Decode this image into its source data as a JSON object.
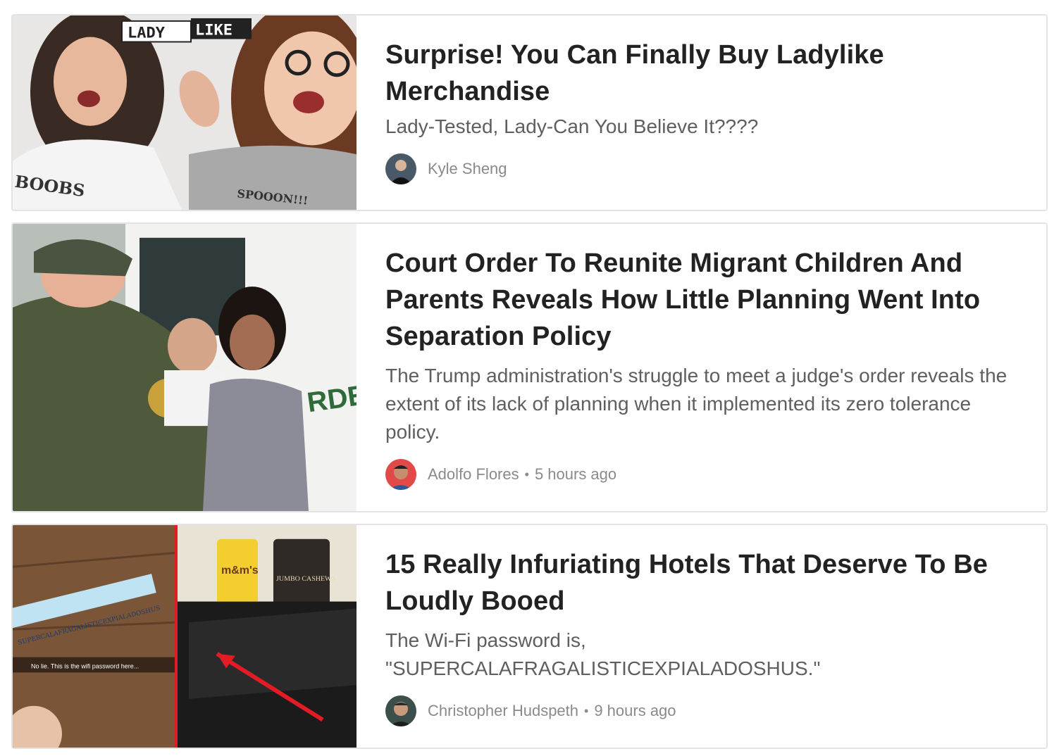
{
  "articles": [
    {
      "title": "Surprise! You Can Finally Buy Ladylike Merchandise",
      "description": "Lady-Tested, Lady-Can You Believe It????",
      "author": "Kyle Sheng",
      "time": "",
      "image": {
        "brand_lady": "LADY",
        "brand_like": "LIKE",
        "shirt_left": "BOOBS",
        "shirt_right": "SPOOON!!!"
      }
    },
    {
      "title": "Court Order To Reunite Migrant Children And Parents Reveals How Little Planning Went Into Separation Policy",
      "description": "The Trump administration's struggle to meet a judge's order reveals the extent of its lack of planning when it implemented its zero tolerance policy.",
      "author": "Adolfo Flores",
      "time": "5 hours ago",
      "image": {
        "vehicle_text": "RDER PA"
      }
    },
    {
      "title": "15 Really Infuriating Hotels That Deserve To Be Loudly Booed",
      "description": "The Wi-Fi password is, \"SUPERCALAFRAGALISTICEXPIALADOSHUS.\"",
      "author": "Christopher Hudspeth",
      "time": "9 hours ago",
      "image": {
        "password_strip": "SUPERCALAFRAGALISTICEXPIALADOSHUS",
        "caption": "No lie. This is the wifi password here...",
        "can_label": "m&m's",
        "jar_label": "JUMBO CASHEWS"
      }
    }
  ],
  "colors": {
    "card_border": "#e3e3e3",
    "headline": "#222222",
    "description": "#5f5f5f",
    "byline": "#8a8a8a"
  }
}
